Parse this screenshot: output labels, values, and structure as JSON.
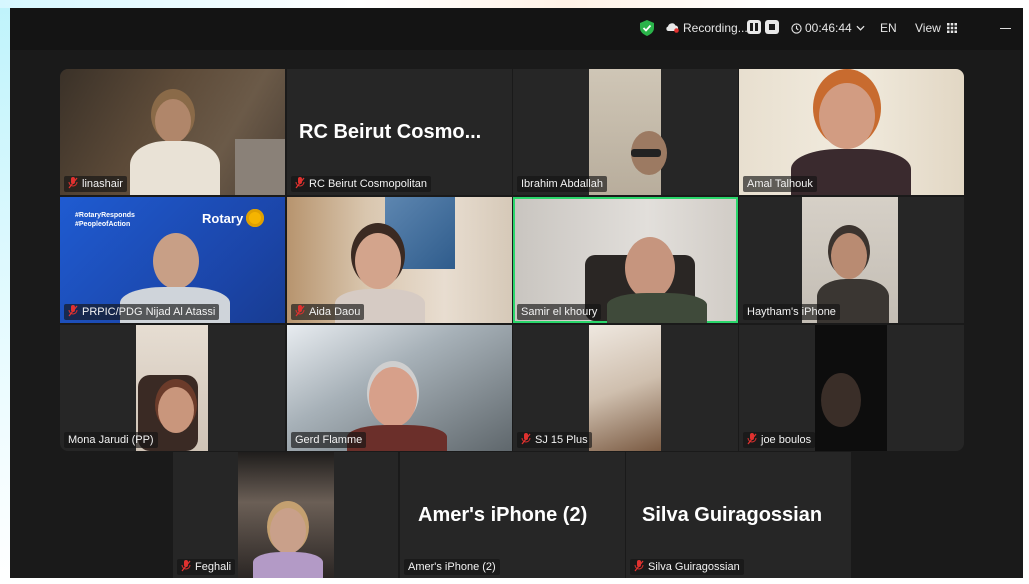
{
  "toolbar": {
    "recording_label": "Recording...",
    "timer": "00:46:44",
    "lang": "EN",
    "view_label": "View",
    "colors": {
      "shield": "#2ab44a",
      "active_speaker": "#2ad66b",
      "mute": "#e0312f"
    }
  },
  "tiles": [
    {
      "name": "linashair",
      "muted": true
    },
    {
      "name": "RC Beirut Cosmopolitan",
      "big_title": "RC Beirut Cosmo...",
      "muted": true
    },
    {
      "name": "Ibrahim Abdallah",
      "muted": false
    },
    {
      "name": "Amal Talhouk",
      "muted": false
    },
    {
      "name": "PRPIC/PDG  Nijad Al Atassi",
      "muted": true,
      "banner": [
        "#RotaryResponds",
        "#PeopleofAction"
      ],
      "brand": "Rotary"
    },
    {
      "name": "Aida Daou",
      "muted": true
    },
    {
      "name": "Samir el khoury",
      "muted": false,
      "active": true
    },
    {
      "name": "Haytham's iPhone",
      "muted": false
    },
    {
      "name": "Mona Jarudi (PP)",
      "muted": false
    },
    {
      "name": "Gerd Flamme",
      "muted": false
    },
    {
      "name": "SJ 15 Plus",
      "muted": true
    },
    {
      "name": "joe boulos",
      "muted": true
    },
    {
      "name": "Feghali",
      "muted": true
    },
    {
      "name": "Amer's iPhone (2)",
      "big_title": "Amer's iPhone (2)",
      "muted": false
    },
    {
      "name": "Silva Guiragossian",
      "big_title": "Silva Guiragossian",
      "muted": true
    }
  ]
}
